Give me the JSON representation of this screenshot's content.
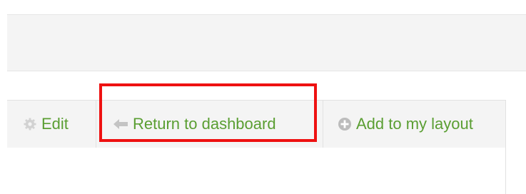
{
  "toolbar": {
    "items": [
      {
        "label": "Edit",
        "icon": "gear-icon"
      },
      {
        "label": "Return to dashboard",
        "icon": "arrow-left-icon"
      },
      {
        "label": "Add to my layout",
        "icon": "plus-circle-icon"
      }
    ]
  },
  "colors": {
    "link": "#5a9e32",
    "highlight": "#ee1111",
    "toolbar_bg": "#f4f4f4",
    "icon_gray": "#c4c4c4"
  }
}
